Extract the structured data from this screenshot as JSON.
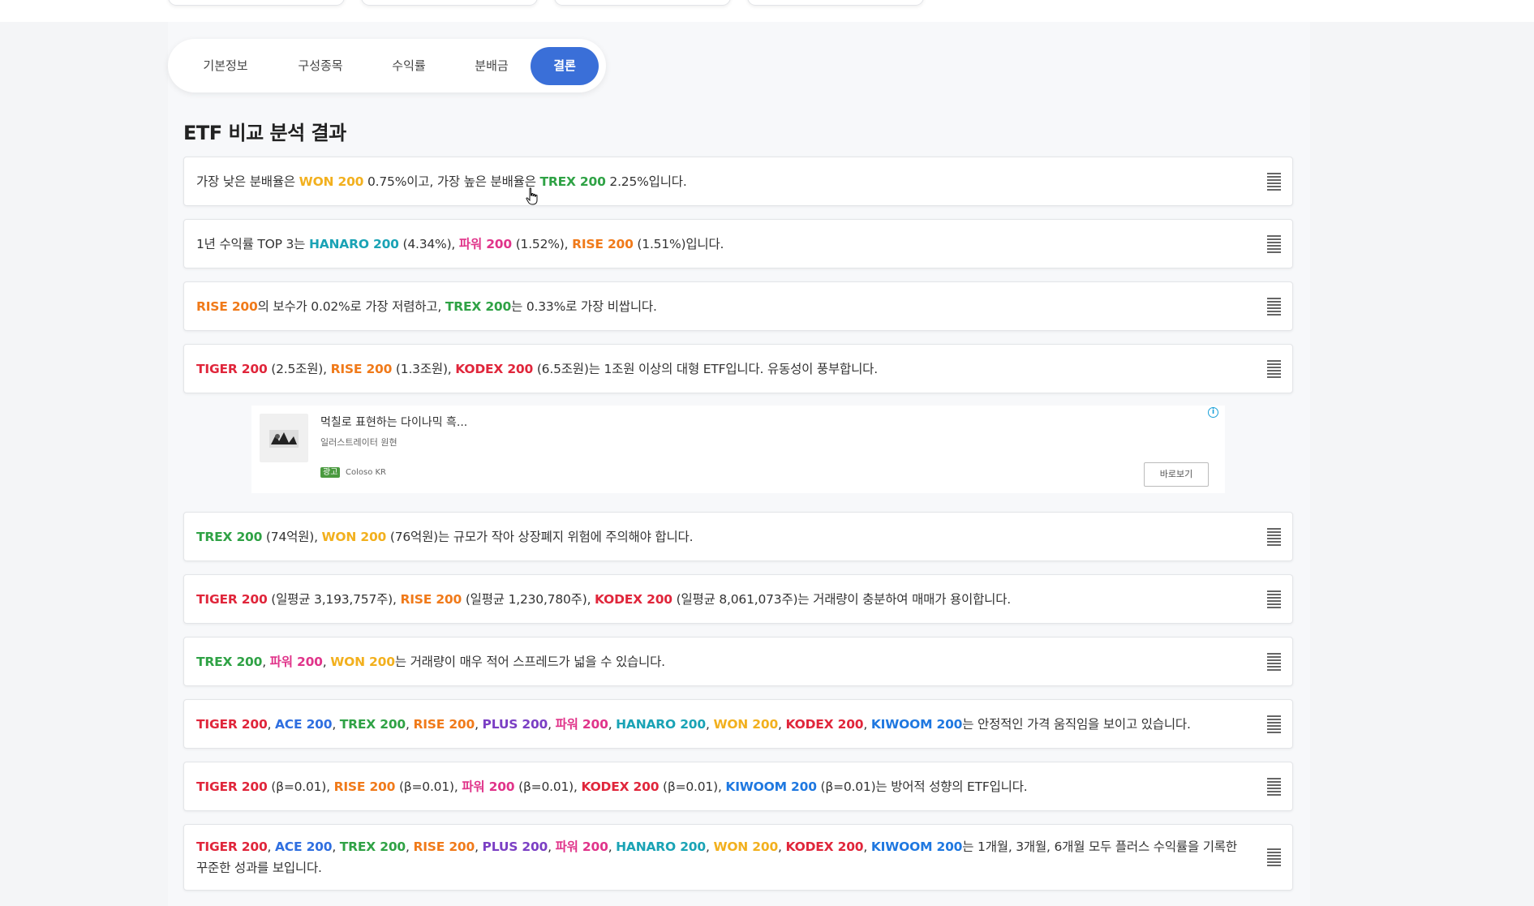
{
  "tabs": [
    {
      "label": "기본정보",
      "active": false
    },
    {
      "label": "구성종목",
      "active": false
    },
    {
      "label": "수익률",
      "active": false
    },
    {
      "label": "분배금",
      "active": false
    },
    {
      "label": "결론",
      "active": true
    }
  ],
  "heading": "ETF 비교 분석 결과",
  "colors": {
    "tiger": "#e0263b",
    "rise": "#f07a1a",
    "kodex": "#e0263b",
    "trex": "#2fa245",
    "won": "#f2b01e",
    "hanaro": "#1aa3b5",
    "pawi": "#e0348a",
    "ace": "#2f6fe0",
    "plus": "#7b3fc4",
    "kiwoom": "#1f78e0",
    "accent": "#3a6fd8"
  },
  "conclusions": [
    {
      "text": [
        {
          "t": "가장 낮은 분배율은 "
        },
        {
          "t": "WON 200",
          "c": "won"
        },
        {
          "t": " 0.75%이고, 가장 높은 분배율은 "
        },
        {
          "t": "TREX 200",
          "c": "trex"
        },
        {
          "t": " 2.25%입니다."
        }
      ]
    },
    {
      "text": [
        {
          "t": "1년 수익률 TOP 3는 "
        },
        {
          "t": "HANARO 200",
          "c": "hanaro"
        },
        {
          "t": " (4.34%), "
        },
        {
          "t": "파워 200",
          "c": "pawi"
        },
        {
          "t": " (1.52%), "
        },
        {
          "t": "RISE 200",
          "c": "rise"
        },
        {
          "t": " (1.51%)입니다."
        }
      ]
    },
    {
      "text": [
        {
          "t": "RISE 200",
          "c": "rise"
        },
        {
          "t": "의 보수가 0.02%로 가장 저렴하고, "
        },
        {
          "t": "TREX 200",
          "c": "trex"
        },
        {
          "t": "는 0.33%로 가장 비쌉니다."
        }
      ]
    },
    {
      "text": [
        {
          "t": "TIGER 200",
          "c": "tiger"
        },
        {
          "t": " (2.5조원), "
        },
        {
          "t": "RISE 200",
          "c": "rise"
        },
        {
          "t": " (1.3조원), "
        },
        {
          "t": "KODEX 200",
          "c": "kodex"
        },
        {
          "t": " (6.5조원)는 1조원 이상의 대형 ETF입니다. 유동성이 풍부합니다."
        }
      ]
    },
    {
      "text": [
        {
          "t": "TREX 200",
          "c": "trex"
        },
        {
          "t": " (74억원), "
        },
        {
          "t": "WON 200",
          "c": "won"
        },
        {
          "t": " (76억원)는 규모가 작아 상장폐지 위험에 주의해야 합니다."
        }
      ]
    },
    {
      "text": [
        {
          "t": "TIGER 200",
          "c": "tiger"
        },
        {
          "t": " (일평균 3,193,757주), "
        },
        {
          "t": "RISE 200",
          "c": "rise"
        },
        {
          "t": " (일평균 1,230,780주), "
        },
        {
          "t": "KODEX 200",
          "c": "kodex"
        },
        {
          "t": " (일평균 8,061,073주)는 거래량이 충분하여 매매가 용이합니다."
        }
      ]
    },
    {
      "text": [
        {
          "t": "TREX 200",
          "c": "trex"
        },
        {
          "t": ", "
        },
        {
          "t": "파워 200",
          "c": "pawi"
        },
        {
          "t": ", "
        },
        {
          "t": "WON 200",
          "c": "won"
        },
        {
          "t": "는 거래량이 매우 적어 스프레드가 넓을 수 있습니다."
        }
      ]
    },
    {
      "text": [
        {
          "t": "TIGER 200",
          "c": "tiger"
        },
        {
          "t": ", "
        },
        {
          "t": "ACE 200",
          "c": "ace"
        },
        {
          "t": ", "
        },
        {
          "t": "TREX 200",
          "c": "trex"
        },
        {
          "t": ", "
        },
        {
          "t": "RISE 200",
          "c": "rise"
        },
        {
          "t": ", "
        },
        {
          "t": "PLUS 200",
          "c": "plus"
        },
        {
          "t": ", "
        },
        {
          "t": "파워 200",
          "c": "pawi"
        },
        {
          "t": ", "
        },
        {
          "t": "HANARO 200",
          "c": "hanaro"
        },
        {
          "t": ", "
        },
        {
          "t": "WON 200",
          "c": "won"
        },
        {
          "t": ", "
        },
        {
          "t": "KODEX 200",
          "c": "kodex"
        },
        {
          "t": ", "
        },
        {
          "t": "KIWOOM 200",
          "c": "kiwoom"
        },
        {
          "t": "는 안정적인 가격 움직임을 보이고 있습니다."
        }
      ]
    },
    {
      "text": [
        {
          "t": "TIGER 200",
          "c": "tiger"
        },
        {
          "t": " (β=0.01), "
        },
        {
          "t": "RISE 200",
          "c": "rise"
        },
        {
          "t": " (β=0.01), "
        },
        {
          "t": "파워 200",
          "c": "pawi"
        },
        {
          "t": " (β=0.01), "
        },
        {
          "t": "KODEX 200",
          "c": "kodex"
        },
        {
          "t": " (β=0.01), "
        },
        {
          "t": "KIWOOM 200",
          "c": "kiwoom"
        },
        {
          "t": " (β=0.01)는 방어적 성향의 ETF입니다."
        }
      ]
    },
    {
      "text": [
        {
          "t": "TIGER 200",
          "c": "tiger"
        },
        {
          "t": ", "
        },
        {
          "t": "ACE 200",
          "c": "ace"
        },
        {
          "t": ", "
        },
        {
          "t": "TREX 200",
          "c": "trex"
        },
        {
          "t": ", "
        },
        {
          "t": "RISE 200",
          "c": "rise"
        },
        {
          "t": ", "
        },
        {
          "t": "PLUS 200",
          "c": "plus"
        },
        {
          "t": ", "
        },
        {
          "t": "파워 200",
          "c": "pawi"
        },
        {
          "t": ", "
        },
        {
          "t": "HANARO 200",
          "c": "hanaro"
        },
        {
          "t": ", "
        },
        {
          "t": "WON 200",
          "c": "won"
        },
        {
          "t": ", "
        },
        {
          "t": "KODEX 200",
          "c": "kodex"
        },
        {
          "t": ", "
        },
        {
          "t": "KIWOOM 200",
          "c": "kiwoom"
        },
        {
          "t": "는 1개월, 3개월, 6개월 모두 플러스 수익률을 기록한 꾸준한 성과를 보입니다."
        }
      ]
    }
  ],
  "ad": {
    "title": "먹칠로 표현하는 다이나믹 흑...",
    "subtitle": "일러스트레이터 원현",
    "badge": "광고",
    "sponsor": "Coloso KR",
    "cta": "바로보기",
    "info": "i"
  }
}
